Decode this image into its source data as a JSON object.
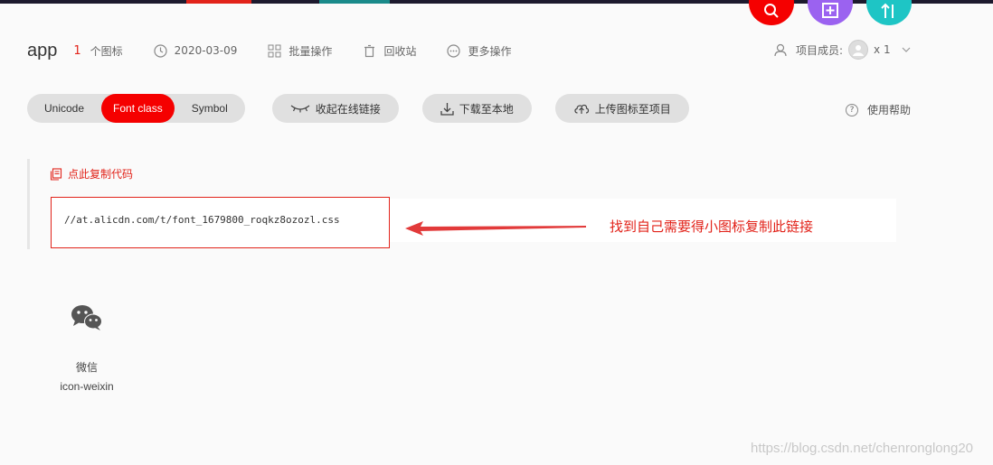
{
  "header": {
    "app_name": "app",
    "icon_count": "1",
    "icon_count_label": "个图标",
    "date": "2020-03-09",
    "batch_ops": "批量操作",
    "recycle_bin": "回收站",
    "more_ops": "更多操作",
    "members_label": "项目成员:",
    "members_count": "x 1"
  },
  "tabs": {
    "unicode": "Unicode",
    "font_class": "Font class",
    "symbol": "Symbol",
    "active": "Font class"
  },
  "actions": {
    "collapse_link": "收起在线链接",
    "download": "下载至本地",
    "upload": "上传图标至项目",
    "help": "使用帮助"
  },
  "code": {
    "copy_label": "点此复制代码",
    "url": "//at.alicdn.com/t/font_1679800_roqkz8ozozl.css"
  },
  "annotation": "找到自己需要得小图标复制此链接",
  "icons": [
    {
      "name": "微信",
      "class_name": "icon-weixin",
      "glyph": "wechat-icon"
    }
  ],
  "watermark": "https://blog.csdn.net/chenronglong20",
  "colors": {
    "accent": "#f50000",
    "fab_search": "#f50000",
    "fab_add": "#9b62f0",
    "fab_sort": "#1ec5c5"
  }
}
